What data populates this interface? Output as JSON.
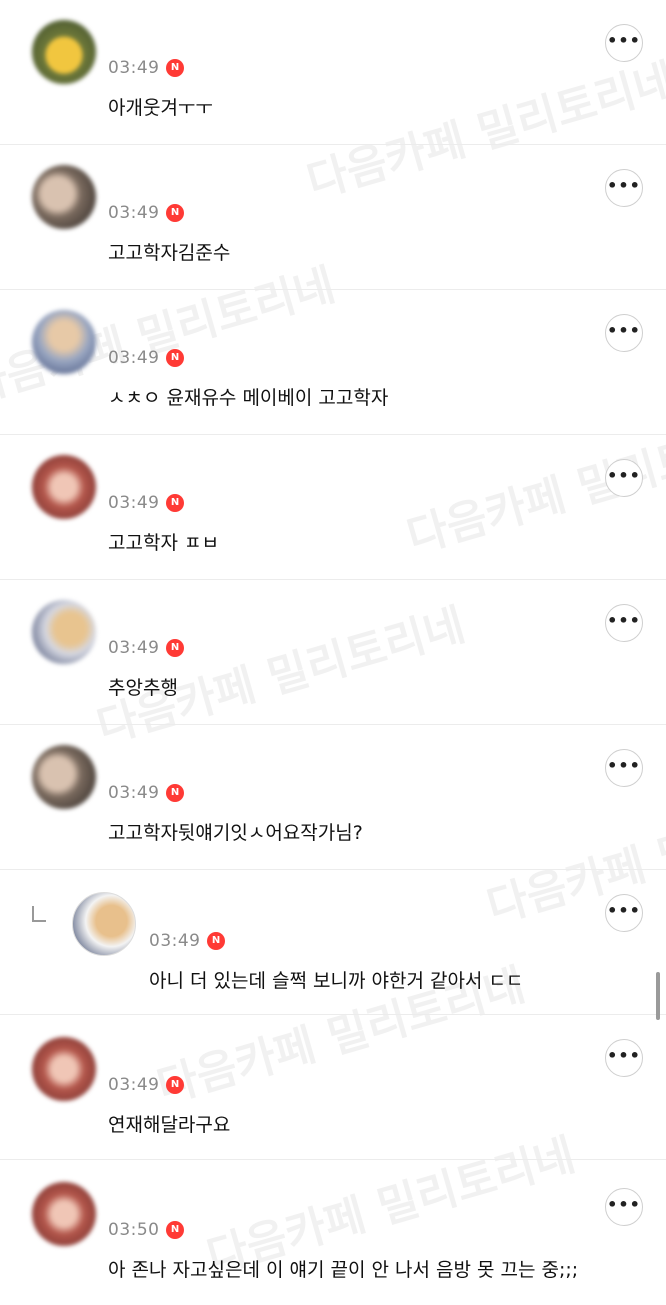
{
  "colors": {
    "badge": "#ff3a35",
    "time": "#8a8a8a",
    "divider": "#ececec"
  },
  "icons": {
    "badge": "n-badge-icon",
    "more": "more-options-icon",
    "reply": "reply-arrow-icon"
  },
  "badge_letter": "N",
  "more_glyph": "•••",
  "watermark": "다음카페 밀리토리네",
  "comments": [
    {
      "time": "03:49",
      "text": "아개웃겨ㅜㅜ"
    },
    {
      "time": "03:49",
      "text": "고고학자김준수"
    },
    {
      "time": "03:49",
      "text": "ㅅㅊㅇ 윤재유수 메이베이 고고학자"
    },
    {
      "time": "03:49",
      "text": "고고학자 ㅍㅂ"
    },
    {
      "time": "03:49",
      "text": "추앙추행"
    },
    {
      "time": "03:49",
      "text": "고고학자뒷얘기잇ㅅ어요작가님?"
    },
    {
      "time": "03:49",
      "text": "아니 더 있는데 슬쩍 보니까 야한거 같아서 ㄷㄷ"
    },
    {
      "time": "03:49",
      "text": "연재해달라구요"
    },
    {
      "time": "03:50",
      "text": "아 존나 자고싶은데 이 얘기 끝이 안 나서 음방 못 끄는 중;;;"
    }
  ]
}
